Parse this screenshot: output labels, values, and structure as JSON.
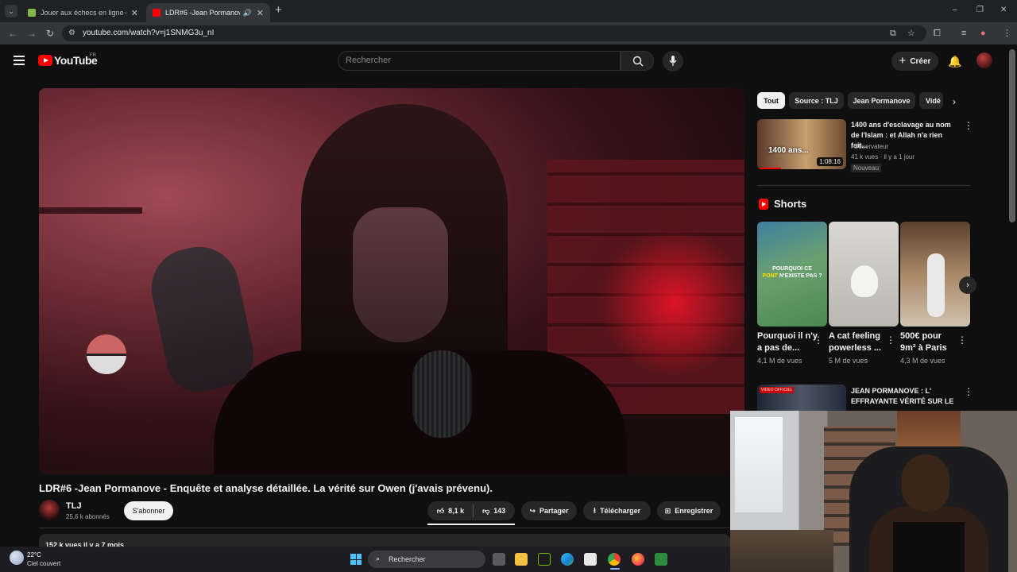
{
  "browser": {
    "tabs": [
      {
        "title": "Jouer aux échecs en ligne conti",
        "favicon_color": "#81b64c"
      },
      {
        "title": "LDR#6 -Jean Pormanove - E",
        "favicon_color": "#ff0000"
      }
    ],
    "new_tab_glyph": "+",
    "window_controls": [
      "–",
      "❐",
      "✕"
    ],
    "url": "youtube.com/watch?v=j1SNMG3u_nI"
  },
  "masthead": {
    "logo_text": "YouTube",
    "country_code": "FR",
    "search_placeholder": "Rechercher",
    "create_label": "Créer"
  },
  "video": {
    "title": "LDR#6 -Jean Pormanove - Enquête et analyse détaillée. La vérité sur Owen (j'avais prévenu).",
    "channel_name": "TLJ",
    "subscribers": "25,6 k abonnés",
    "subscribe_label": "S'abonner",
    "likes": "8,1 k",
    "dislikes": "143",
    "share_label": "Partager",
    "download_label": "Télécharger",
    "save_label": "Enregistrer",
    "description_meta": "152 k vues  il y a 7 mois"
  },
  "sidebar": {
    "chips": [
      {
        "label": "Tout",
        "active": true
      },
      {
        "label": "Source : TLJ",
        "active": false
      },
      {
        "label": "Jean Pormanove",
        "active": false
      },
      {
        "label": "Vidé",
        "active": false
      }
    ],
    "recommendation": {
      "thumbnail_text": "1400 ans...",
      "duration": "1:08:16",
      "title": "1400 ans d'esclavage au nom de l'Islam : et Allah n'a rien fait...",
      "channel": "l'Observateur",
      "meta": "41 k vues · il y a 1 jour",
      "badge": "Nouveau"
    },
    "shorts_heading": "Shorts",
    "shorts": [
      {
        "overlay_white": "POURQUOI CE",
        "overlay_yellow": "PONT",
        "overlay_rest": "N'EXISTE PAS ?",
        "title": "Pourquoi il n'y a pas de...",
        "views": "4,1 M de vues"
      },
      {
        "title": "A cat feeling powerless ...",
        "views": "5 M de vues"
      },
      {
        "title": "500€ pour 9m² à Paris",
        "views": "4,3 M de vues"
      }
    ],
    "recommendation2": {
      "live_badge": "VIDEO OFFICIEL",
      "title": "JEAN PORMANOVE : L' EFFRAYANTE VÉRITÉ SUR LE ..."
    }
  },
  "taskbar": {
    "temperature": "22°C",
    "weather": "Ciel couvert",
    "search_placeholder": "Rechercher"
  }
}
